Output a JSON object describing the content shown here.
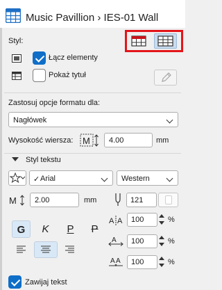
{
  "window": {
    "title": "Music Pavillion › IES-01  Wall"
  },
  "style_section": {
    "label": "Styl:",
    "join_elements_label": "Łącz elementy",
    "join_elements_checked": true,
    "show_title_label": "Pokaż tytuł",
    "show_title_checked": false
  },
  "format_scope": {
    "label": "Zastosuj opcje formatu dla:",
    "selected": "Nagłówek"
  },
  "row_height": {
    "label": "Wysokość wiersza:",
    "value": "4.00",
    "unit": "mm"
  },
  "text_style": {
    "header": "Styl tekstu",
    "font": "Arial",
    "font_check": "✓",
    "script": "Western",
    "size_value": "2.00",
    "size_unit": "mm",
    "pen_value": "121",
    "bold_label": "G",
    "italic_label": "K",
    "underline_label": "P",
    "strike_label": "P",
    "width_pct": "100",
    "spacing_pct": "100",
    "slant_pct": "100",
    "pct_symbol": "%",
    "wrap_label": "Zawijaj tekst",
    "wrap_checked": true
  },
  "colors": {
    "accent": "#0f6ec8",
    "highlight_border": "#e3151a"
  },
  "icons": {
    "app": "schedule-grid-icon",
    "edit": "pencil-icon"
  }
}
